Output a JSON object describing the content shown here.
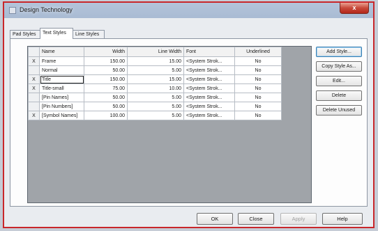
{
  "window": {
    "title": "Design Technology",
    "close_glyph": "x"
  },
  "tabs": [
    {
      "label": "Pad Styles"
    },
    {
      "label": "Text Styles",
      "active": true
    },
    {
      "label": "Line Styles"
    }
  ],
  "table": {
    "columns": [
      "",
      "Name",
      "Width",
      "Line Width",
      "Font",
      "Underlined"
    ],
    "rows": [
      {
        "mark": "X",
        "name": "Frame",
        "width": "150.00",
        "line_width": "15.00",
        "font": "<System Strok...",
        "underlined": "No"
      },
      {
        "mark": "",
        "name": "Normal",
        "width": "50.00",
        "line_width": "5.00",
        "font": "<System Strok...",
        "underlined": "No"
      },
      {
        "mark": "X",
        "name": "Title",
        "width": "150.00",
        "line_width": "15.00",
        "font": "<System Strok...",
        "underlined": "No"
      },
      {
        "mark": "X",
        "name": "Title-small",
        "width": "75.00",
        "line_width": "10.00",
        "font": "<System Strok...",
        "underlined": "No"
      },
      {
        "mark": "",
        "name": "[Pin Names]",
        "width": "50.00",
        "line_width": "5.00",
        "font": "<System Strok...",
        "underlined": "No"
      },
      {
        "mark": "",
        "name": "[Pin Numbers]",
        "width": "50.00",
        "line_width": "5.00",
        "font": "<System Strok...",
        "underlined": "No"
      },
      {
        "mark": "X",
        "name": "[Symbol Names]",
        "width": "100.00",
        "line_width": "5.00",
        "font": "<System Strok...",
        "underlined": "No"
      }
    ]
  },
  "side_buttons": {
    "add_style": "Add Style...",
    "copy_style": "Copy Style As...",
    "edit": "Edit...",
    "delete": "Delete",
    "delete_unused": "Delete Unused"
  },
  "bottom_buttons": {
    "ok": "OK",
    "close": "Close",
    "apply": "Apply",
    "help": "Help"
  },
  "colors": {
    "title_border": "#c9262a",
    "grid_background": "#a0a4a9",
    "close_button": "#c8493a"
  }
}
